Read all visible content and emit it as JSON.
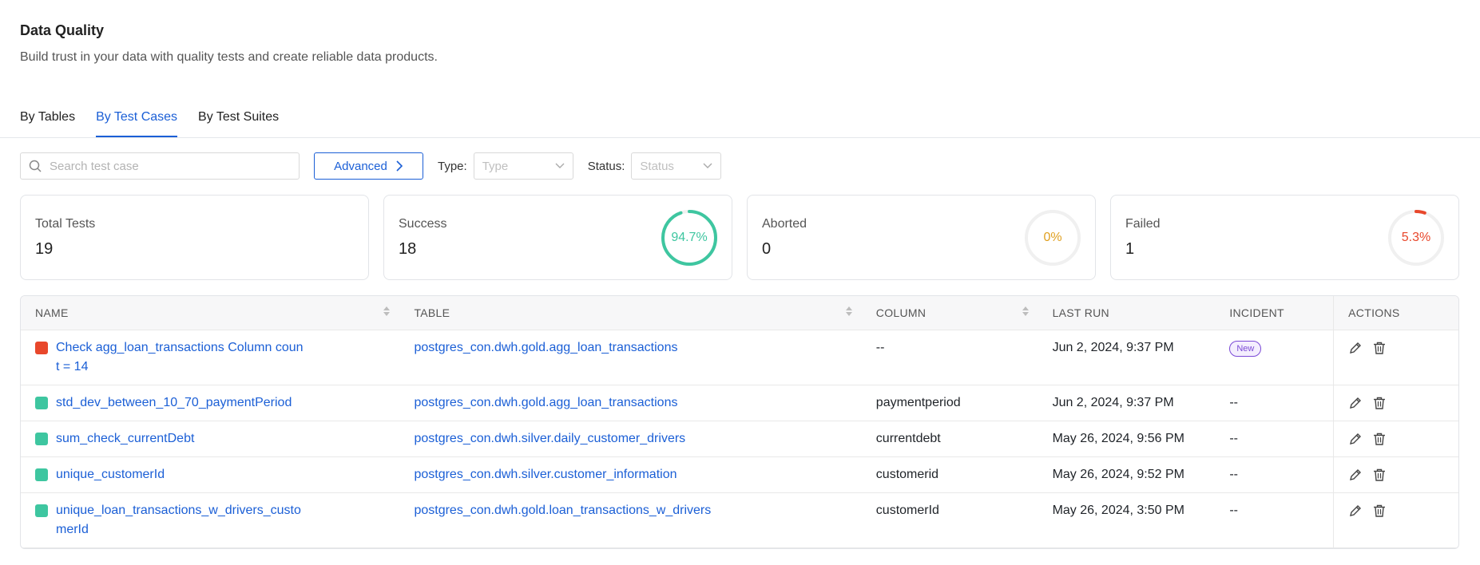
{
  "header": {
    "title": "Data Quality",
    "subtitle": "Build trust in your data with quality tests and create reliable data products."
  },
  "tabs": [
    {
      "label": "By Tables",
      "active": false
    },
    {
      "label": "By Test Cases",
      "active": true
    },
    {
      "label": "By Test Suites",
      "active": false
    }
  ],
  "filters": {
    "search_placeholder": "Search test case",
    "advanced_label": "Advanced",
    "type_label": "Type",
    "type_placeholder": "Type",
    "status_label": "Status",
    "status_placeholder": "Status",
    "colon": ":"
  },
  "summary": {
    "total": {
      "label": "Total Tests",
      "value": "19"
    },
    "success": {
      "label": "Success",
      "value": "18",
      "percent_text": "94.7%",
      "fraction": 0.947,
      "color": "#3ec6a0"
    },
    "aborted": {
      "label": "Aborted",
      "value": "0",
      "percent_text": "0%",
      "fraction": 0,
      "color": "#e0a020"
    },
    "failed": {
      "label": "Failed",
      "value": "1",
      "percent_text": "5.3%",
      "fraction": 0.053,
      "color": "#e8472b"
    }
  },
  "table": {
    "columns": {
      "name": "NAME",
      "table": "TABLE",
      "column": "COLUMN",
      "last_run": "LAST RUN",
      "incident": "INCIDENT",
      "actions": "ACTIONS"
    },
    "rows": [
      {
        "status_color": "#e8472b",
        "name": "Check agg_loan_transactions Column count = 14",
        "table": "postgres_con.dwh.gold.agg_loan_transactions",
        "column": "--",
        "last_run": "Jun 2, 2024, 9:37 PM",
        "incident": "New",
        "incident_is_badge": true
      },
      {
        "status_color": "#3ec6a0",
        "name": "std_dev_between_10_70_paymentPeriod",
        "table": "postgres_con.dwh.gold.agg_loan_transactions",
        "column": "paymentperiod",
        "last_run": "Jun 2, 2024, 9:37 PM",
        "incident": "--",
        "incident_is_badge": false
      },
      {
        "status_color": "#3ec6a0",
        "name": "sum_check_currentDebt",
        "table": "postgres_con.dwh.silver.daily_customer_drivers",
        "column": "currentdebt",
        "last_run": "May 26, 2024, 9:56 PM",
        "incident": "--",
        "incident_is_badge": false
      },
      {
        "status_color": "#3ec6a0",
        "name": "unique_customerId",
        "table": "postgres_con.dwh.silver.customer_information",
        "column": "customerid",
        "last_run": "May 26, 2024, 9:52 PM",
        "incident": "--",
        "incident_is_badge": false
      },
      {
        "status_color": "#3ec6a0",
        "name": "unique_loan_transactions_w_drivers_customerId",
        "table": "postgres_con.dwh.gold.loan_transactions_w_drivers",
        "column": "customerId",
        "last_run": "May 26, 2024, 3:50 PM",
        "incident": "--",
        "incident_is_badge": false
      }
    ]
  }
}
